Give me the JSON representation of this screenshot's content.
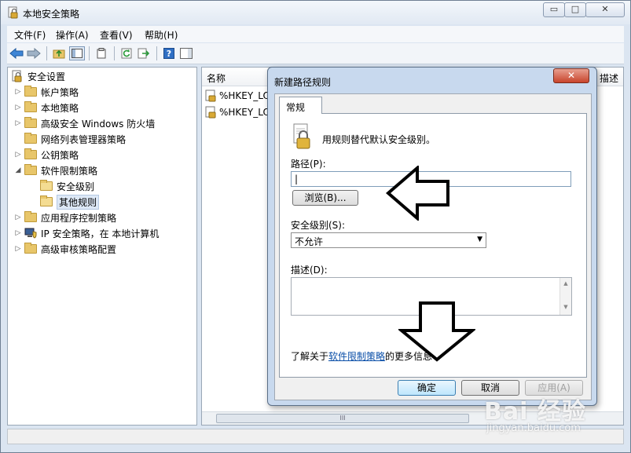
{
  "window": {
    "title": "本地安全策略",
    "minimize_glyph": "▭",
    "maximize_glyph": "□",
    "close_glyph": "✕"
  },
  "menu": [
    "文件(F)",
    "操作(A)",
    "查看(V)",
    "帮助(H)"
  ],
  "toolbar": {
    "icons": [
      "back-arrow-icon",
      "forward-arrow-icon",
      "up-folder-icon",
      "show-hide-tree-icon",
      "properties-icon",
      "refresh-icon",
      "export-list-icon",
      "help-icon",
      "show-action-pane-icon"
    ]
  },
  "tree": {
    "root": "安全设置",
    "items": [
      {
        "label": "帐户策略",
        "expander": "▷"
      },
      {
        "label": "本地策略",
        "expander": "▷"
      },
      {
        "label": "高级安全 Windows 防火墙",
        "expander": "▷"
      },
      {
        "label": "网络列表管理器策略",
        "expander": ""
      },
      {
        "label": "公钥策略",
        "expander": "▷"
      },
      {
        "label": "软件限制策略",
        "expander": "◢"
      },
      {
        "label": "安全级别",
        "expander": ""
      },
      {
        "label": "其他规则",
        "expander": ""
      },
      {
        "label": "应用程序控制策略",
        "expander": "▷"
      },
      {
        "label": "IP 安全策略，在 本地计算机",
        "expander": "▷"
      },
      {
        "label": "高级审核策略配置",
        "expander": "▷"
      }
    ]
  },
  "list": {
    "columns": [
      "名称",
      "描述"
    ],
    "rows": [
      "%HKEY_LO",
      "%HKEY_LO"
    ],
    "scroll_grip": "III"
  },
  "dialog": {
    "title": "新建路径规则",
    "close_glyph": "✕",
    "tab": "常规",
    "intro": "用规则替代默认安全级别。",
    "path_label": "路径(P):",
    "path_value": "|",
    "browse_button": "浏览(B)...",
    "level_label": "安全级别(S):",
    "level_value": "不允许",
    "level_arrow": "▼",
    "desc_label": "描述(D):",
    "desc_scroll_up": "▲",
    "desc_scroll_down": "▼",
    "learn_prefix": "了解关于",
    "learn_link": "软件限制策略",
    "learn_suffix": "的更多信息",
    "ok": "确定",
    "cancel": "取消",
    "apply": "应用(A)"
  },
  "watermark": {
    "brand": "Bai 经验",
    "url": "jingyan.baidu.com"
  },
  "colors": {
    "window_frame": "#dbe5f1",
    "link": "#0b4fa8",
    "dialog_frame": "#c8d9ee",
    "close_button": "#c8442c"
  }
}
